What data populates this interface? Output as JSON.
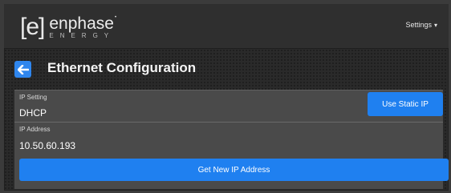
{
  "brand": {
    "mark": "[e]",
    "name": "enphase",
    "registered": "•",
    "subtitle": "ENERGY"
  },
  "header": {
    "settings_label": "Settings",
    "settings_caret": "▾"
  },
  "page": {
    "title": "Ethernet Configuration"
  },
  "form": {
    "ip_setting_label": "IP Setting",
    "ip_setting_value": "DHCP",
    "use_static_ip_label": "Use Static IP",
    "ip_address_label": "IP Address",
    "ip_address_value": "10.50.60.193",
    "get_new_ip_label": "Get New IP Address"
  },
  "colors": {
    "accent": "#1f80f0",
    "header_bg": "#2f2f2f",
    "panel_bg": "#4a4a4a"
  },
  "icons": {
    "back": "arrow-left-icon",
    "dropdown": "chevron-down-icon"
  }
}
